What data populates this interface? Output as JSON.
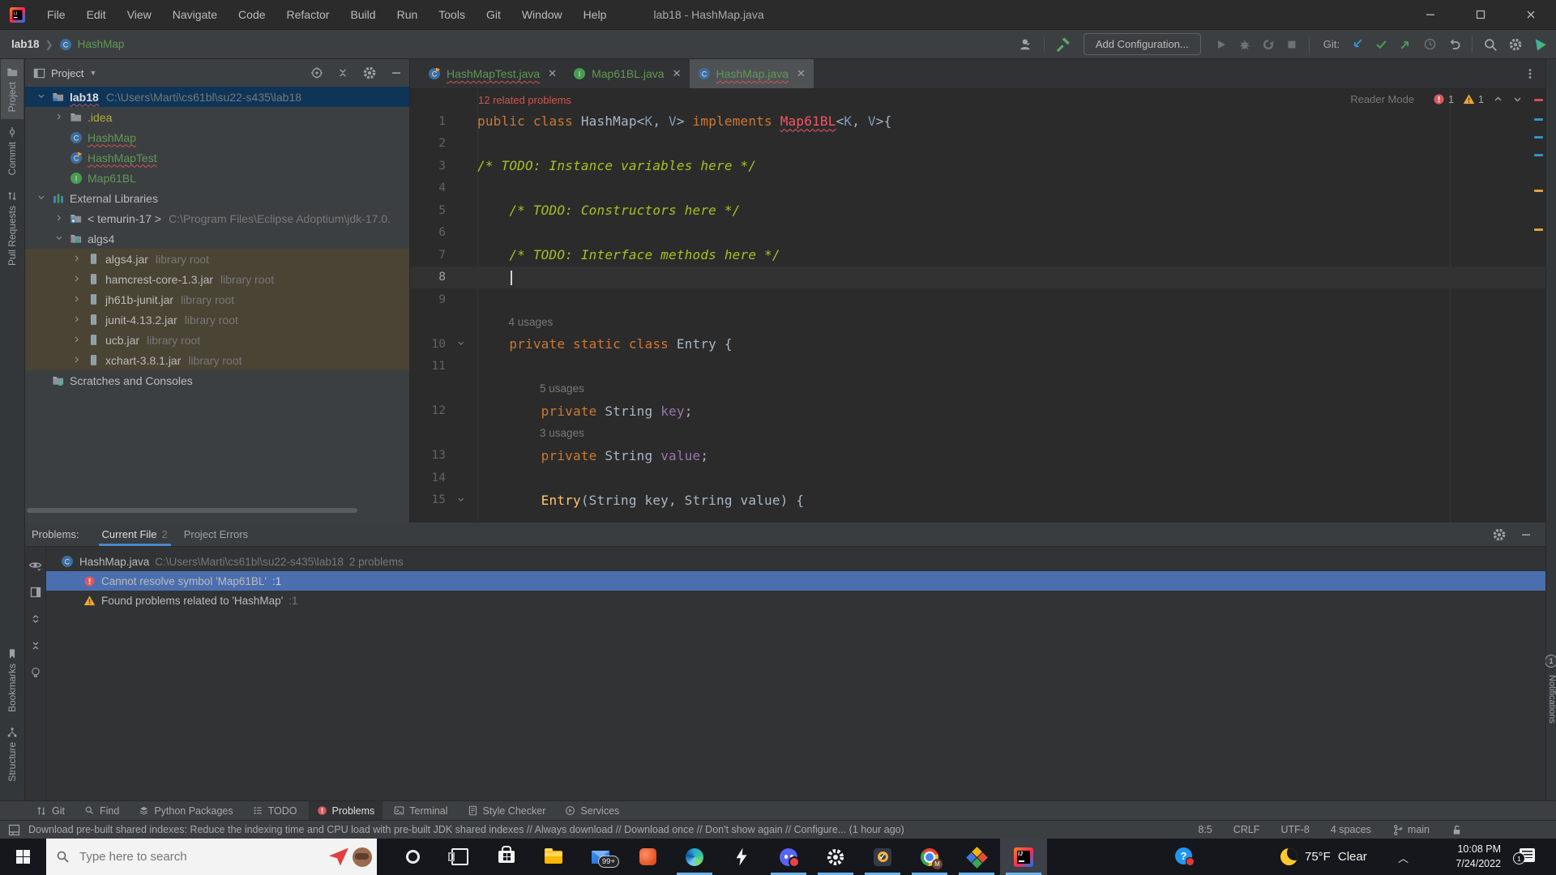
{
  "title_bar": {
    "title": "lab18 - HashMap.java",
    "menus": [
      "File",
      "Edit",
      "View",
      "Navigate",
      "Code",
      "Refactor",
      "Build",
      "Run",
      "Tools",
      "Git",
      "Window",
      "Help"
    ]
  },
  "nav_bar": {
    "project": "lab18",
    "target": "HashMap",
    "add_configuration": "Add Configuration...",
    "git_label": "Git:"
  },
  "editor_tabs": [
    {
      "label": "HashMapTest.java",
      "icon": "class-run",
      "error": true,
      "active": false
    },
    {
      "label": "Map61BL.java",
      "icon": "interface",
      "error": false,
      "active": false
    },
    {
      "label": "HashMap.java",
      "icon": "class",
      "error": true,
      "active": true
    }
  ],
  "left_stripe": {
    "top": [
      "Project",
      "Commit",
      "Pull Requests"
    ],
    "bottom": [
      "Bookmarks",
      "Structure"
    ]
  },
  "right_stripe": {
    "label": "Notifications",
    "badge": "1"
  },
  "project_panel": {
    "title": "Project",
    "rows": [
      {
        "depth": 0,
        "chevron": "down",
        "icon": "folder-project",
        "label": "lab18",
        "path": "C:\\Users\\Marti\\cs61bl\\su22-s435\\lab18",
        "bold": true,
        "selected": true,
        "squiggle": true
      },
      {
        "depth": 1,
        "chevron": "right",
        "icon": "folder",
        "label": ".idea",
        "color": "olive-t"
      },
      {
        "depth": 1,
        "chevron": "",
        "icon": "class",
        "label": "HashMap",
        "color": "green",
        "squiggle": true
      },
      {
        "depth": 1,
        "chevron": "",
        "icon": "class-run",
        "label": "HashMapTest",
        "color": "green",
        "squiggle": true
      },
      {
        "depth": 1,
        "chevron": "",
        "icon": "interface",
        "label": "Map61BL",
        "color": "green"
      },
      {
        "depth": 0,
        "chevron": "down",
        "icon": "ext-lib",
        "label": "External Libraries"
      },
      {
        "depth": 1,
        "chevron": "right",
        "icon": "jdk",
        "label": "< temurin-17 >",
        "path": "C:\\Program Files\\Eclipse Adoptium\\jdk-17.0."
      },
      {
        "depth": 1,
        "chevron": "down",
        "icon": "library",
        "label": "algs4"
      },
      {
        "depth": 2,
        "chevron": "right",
        "icon": "jar",
        "label": "algs4.jar",
        "suffix": "library root",
        "olive": true
      },
      {
        "depth": 2,
        "chevron": "right",
        "icon": "jar",
        "label": "hamcrest-core-1.3.jar",
        "suffix": "library root",
        "olive": true
      },
      {
        "depth": 2,
        "chevron": "right",
        "icon": "jar",
        "label": "jh61b-junit.jar",
        "suffix": "library root",
        "olive": true
      },
      {
        "depth": 2,
        "chevron": "right",
        "icon": "jar",
        "label": "junit-4.13.2.jar",
        "suffix": "library root",
        "olive": true
      },
      {
        "depth": 2,
        "chevron": "right",
        "icon": "jar",
        "label": "ucb.jar",
        "suffix": "library root",
        "olive": true
      },
      {
        "depth": 2,
        "chevron": "right",
        "icon": "jar",
        "label": "xchart-3.8.1.jar",
        "suffix": "library root",
        "olive": true
      },
      {
        "depth": 0,
        "chevron": "",
        "icon": "scratches",
        "label": "Scratches and Consoles"
      }
    ]
  },
  "editor": {
    "related_problems": "12 related problems",
    "reader_mode": "Reader Mode",
    "error_count": "1",
    "warning_count": "1",
    "lines": [
      {
        "num": "1",
        "segments": [
          [
            "public class ",
            "kw"
          ],
          [
            "HashMap",
            "pl"
          ],
          [
            "<",
            "pl"
          ],
          [
            "K",
            "tp"
          ],
          [
            ", ",
            "pl"
          ],
          [
            "V",
            "tp"
          ],
          [
            "> ",
            "pl"
          ],
          [
            "implements ",
            "kw"
          ],
          [
            "Map61BL",
            "err"
          ],
          [
            "<",
            "pl"
          ],
          [
            "K",
            "tp"
          ],
          [
            ", ",
            "pl"
          ],
          [
            "V",
            "tp"
          ],
          [
            ">{",
            "pl"
          ]
        ]
      },
      {
        "num": "2",
        "segments": []
      },
      {
        "num": "3",
        "segments": [
          [
            "/* TODO: Instance variables here */",
            "todo"
          ]
        ]
      },
      {
        "num": "4",
        "segments": []
      },
      {
        "num": "5",
        "segments": [
          [
            "    ",
            "pl"
          ],
          [
            "/* TODO: Constructors here */",
            "todo"
          ]
        ]
      },
      {
        "num": "6",
        "segments": []
      },
      {
        "num": "7",
        "segments": [
          [
            "    ",
            "pl"
          ],
          [
            "/* TODO: Interface methods here */",
            "todo"
          ]
        ]
      },
      {
        "num": "8",
        "segments": [],
        "cursor": true
      },
      {
        "num": "9",
        "segments": []
      },
      {
        "hint": "4 usages",
        "indent": 4
      },
      {
        "num": "10",
        "fold": true,
        "segments": [
          [
            "    ",
            "pl"
          ],
          [
            "private static class ",
            "kw"
          ],
          [
            "Entry",
            "pl"
          ],
          [
            " {",
            "pl"
          ]
        ]
      },
      {
        "num": "11",
        "segments": []
      },
      {
        "hint": "5 usages",
        "indent": 8
      },
      {
        "num": "12",
        "segments": [
          [
            "        ",
            "pl"
          ],
          [
            "private ",
            "kw"
          ],
          [
            "String ",
            "pl"
          ],
          [
            "key",
            "fld"
          ],
          [
            ";",
            "pl"
          ]
        ]
      },
      {
        "hint": "3 usages",
        "indent": 8
      },
      {
        "num": "13",
        "segments": [
          [
            "        ",
            "pl"
          ],
          [
            "private ",
            "kw"
          ],
          [
            "String ",
            "pl"
          ],
          [
            "value",
            "fld"
          ],
          [
            ";",
            "pl"
          ]
        ]
      },
      {
        "num": "14",
        "segments": []
      },
      {
        "num": "15",
        "fold": true,
        "segments": [
          [
            "        ",
            "pl"
          ],
          [
            "Entry",
            "mth"
          ],
          [
            "(String key, String value) {",
            "pl"
          ]
        ]
      }
    ]
  },
  "problems_panel": {
    "label": "Problems:",
    "tabs": [
      {
        "label": "Current File",
        "count": "2",
        "active": true
      },
      {
        "label": "Project Errors",
        "count": "",
        "active": false
      }
    ],
    "file": {
      "label": "HashMap.java",
      "path": "C:\\Users\\Marti\\cs61bl\\su22-s435\\lab18",
      "suffix": "2 problems"
    },
    "items": [
      {
        "severity": "error",
        "text": "Cannot resolve symbol 'Map61BL'",
        "loc": ":1",
        "selected": true
      },
      {
        "severity": "warning",
        "text": "Found problems related to 'HashMap'",
        "loc": ":1",
        "selected": false
      }
    ]
  },
  "tool_bar_bottom": [
    {
      "icon": "git",
      "label": "Git",
      "active": false
    },
    {
      "icon": "find",
      "label": "Find",
      "active": false
    },
    {
      "icon": "python",
      "label": "Python Packages",
      "active": false
    },
    {
      "icon": "todo",
      "label": "TODO",
      "active": false
    },
    {
      "icon": "problems",
      "label": "Problems",
      "active": true
    },
    {
      "icon": "terminal",
      "label": "Terminal",
      "active": false
    },
    {
      "icon": "style",
      "label": "Style Checker",
      "active": false
    },
    {
      "icon": "services",
      "label": "Services",
      "active": false
    }
  ],
  "status_bar": {
    "message": "Download pre-built shared indexes: Reduce the indexing time and CPU load with pre-built JDK shared indexes // Always download // Download once // Don't show again // Configure... (1 hour ago)",
    "caret": "8:5",
    "line_ending": "CRLF",
    "encoding": "UTF-8",
    "indent": "4 spaces",
    "branch": "main"
  },
  "taskbar": {
    "search_placeholder": "Type here to search",
    "apps": [
      "opera",
      "task-view",
      "store",
      "explorer",
      "mail",
      "office",
      "edge",
      "bolt",
      "discord",
      "settings",
      "norton",
      "chrome",
      "diamond",
      "intellij"
    ],
    "running": [
      "edge",
      "discord",
      "settings",
      "norton",
      "chrome",
      "diamond",
      "intellij"
    ],
    "active_app": "intellij",
    "mail_badge": "99+",
    "weather_temp": "75°F",
    "weather_desc": "Clear",
    "time": "10:08 PM",
    "date": "7/24/2022",
    "notification_badge": "1"
  },
  "colors": {
    "keyword": "#cc7832",
    "todo": "#a8c023",
    "error": "#f75464",
    "field": "#9876aa",
    "method": "#ffc66d",
    "added_green": "#629755",
    "accent_blue": "#3592c4",
    "run_green": "#499c54",
    "warning": "#f0a732"
  }
}
